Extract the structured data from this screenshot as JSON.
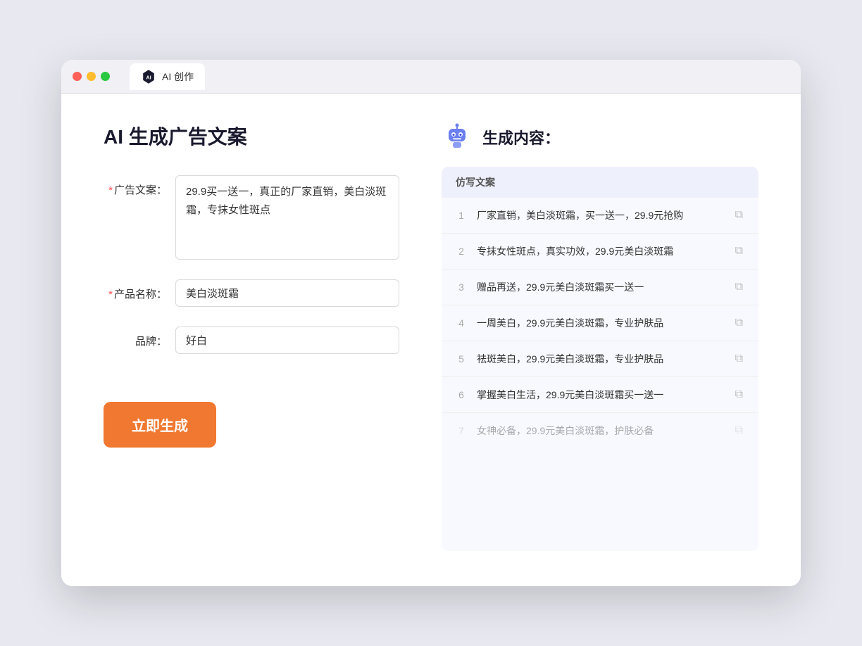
{
  "browser": {
    "tab_label": "AI 创作"
  },
  "page": {
    "title": "AI 生成广告文案",
    "result_title": "生成内容："
  },
  "form": {
    "ad_copy_label": "广告文案：",
    "ad_copy_value": "29.9买一送一，真正的厂家直销，美白淡斑霜，专抹女性斑点",
    "product_name_label": "产品名称：",
    "product_name_value": "美白淡斑霜",
    "brand_label": "品牌：",
    "brand_value": "好白",
    "generate_button": "立即生成",
    "required_mark": "*"
  },
  "results": {
    "table_header": "仿写文案",
    "items": [
      {
        "id": 1,
        "text": "厂家直销，美白淡斑霜，买一送一，29.9元抢购"
      },
      {
        "id": 2,
        "text": "专抹女性斑点，真实功效，29.9元美白淡斑霜"
      },
      {
        "id": 3,
        "text": "赠品再送，29.9元美白淡斑霜买一送一"
      },
      {
        "id": 4,
        "text": "一周美白，29.9元美白淡斑霜，专业护肤品"
      },
      {
        "id": 5,
        "text": "祛斑美白，29.9元美白淡斑霜，专业护肤品"
      },
      {
        "id": 6,
        "text": "掌握美白生活，29.9元美白淡斑霜买一送一"
      },
      {
        "id": 7,
        "text": "女神必备，29.9元美白淡斑霜，护肤必备",
        "faded": true
      }
    ]
  },
  "colors": {
    "orange": "#f07830",
    "accent": "#5b6af0",
    "required": "#ff4d4f"
  }
}
